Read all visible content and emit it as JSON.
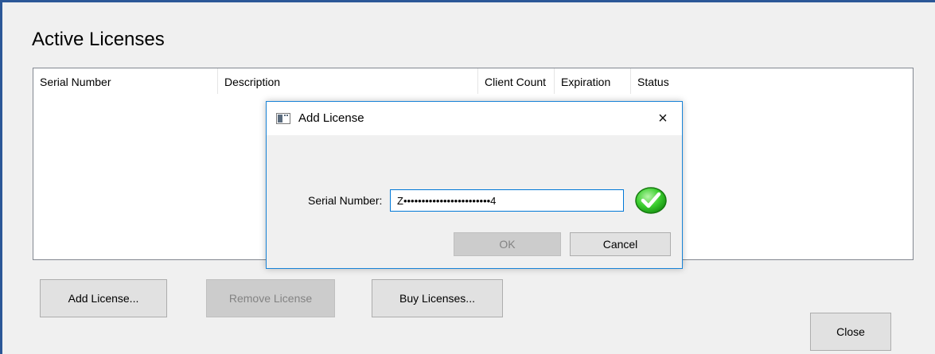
{
  "page": {
    "title": "Active Licenses"
  },
  "license_table": {
    "columns": [
      "Serial Number",
      "Description",
      "Client Count",
      "Expiration",
      "Status"
    ],
    "rows": []
  },
  "buttons": {
    "add_license": "Add License...",
    "remove_license": "Remove License",
    "buy_licenses": "Buy Licenses...",
    "close": "Close"
  },
  "dialog": {
    "title": "Add License",
    "close_glyph": "×",
    "serial_label": "Serial Number:",
    "serial_value": "Z••••••••••••••••••••••••4",
    "validation_icon": "green-checkmark-icon",
    "ok_label": "OK",
    "cancel_label": "Cancel"
  },
  "colors": {
    "accent": "#1883d7",
    "valid_green": "#2fc42b",
    "window_bg": "#f0f0f0"
  }
}
